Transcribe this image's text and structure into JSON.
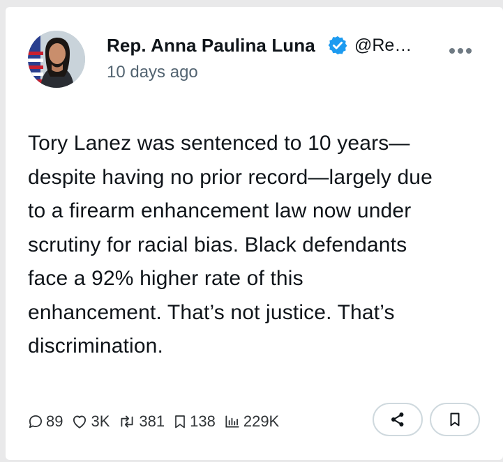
{
  "author": {
    "name": "Rep. Anna Paulina Luna",
    "handle": "@Re…",
    "time": "10 days ago",
    "avatar_icon": "profile-photo-flag"
  },
  "post": {
    "lines": [
      "Tory Lanez was sentenced to 10 years—",
      "despite having no prior record—largely due",
      "to a firearm enhancement law now under",
      "scrutiny for racial bias. Black defendants",
      "face a 92% higher rate of this",
      "enhancement. That’s not justice. That’s",
      "discrimination."
    ]
  },
  "stats": {
    "replies": "89",
    "likes": "3K",
    "reposts": "381",
    "bookmarks": "138",
    "views": "229K"
  },
  "colors": {
    "verified": "#1d9bf0",
    "muted": "#536471",
    "border": "#cfd9de"
  }
}
